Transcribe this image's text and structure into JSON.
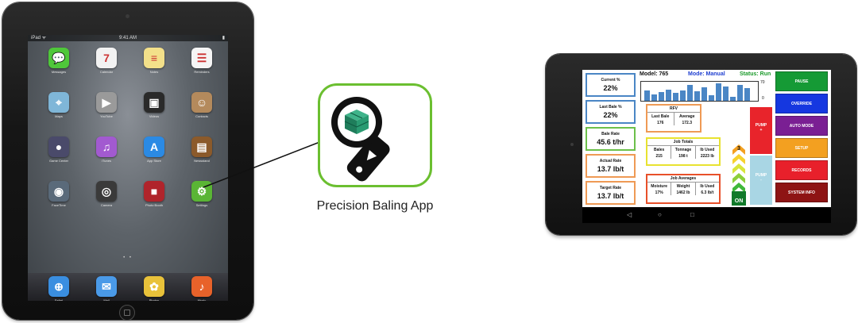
{
  "ipad": {
    "status": {
      "carrier": "iPad ᯤ",
      "clock": "9:41 AM",
      "battery": "▮"
    },
    "apps": [
      {
        "name": "Messages",
        "glyph": "💬",
        "color": "#4fc73a"
      },
      {
        "name": "Calendar",
        "glyph": "7",
        "color": "#f2f2f2"
      },
      {
        "name": "Notes",
        "glyph": "≡",
        "color": "#f3e08a"
      },
      {
        "name": "Reminders",
        "glyph": "☰",
        "color": "#f5f5f5"
      },
      {
        "name": "Maps",
        "glyph": "⌖",
        "color": "#7fb6d8"
      },
      {
        "name": "YouTube",
        "glyph": "▶",
        "color": "#9a9a9a"
      },
      {
        "name": "Videos",
        "glyph": "▣",
        "color": "#2a2a2a"
      },
      {
        "name": "Contacts",
        "glyph": "☺",
        "color": "#b48a5c"
      },
      {
        "name": "Game Center",
        "glyph": "●",
        "color": "#4a4a6a"
      },
      {
        "name": "iTunes",
        "glyph": "♫",
        "color": "#a25ad0"
      },
      {
        "name": "App Store",
        "glyph": "A",
        "color": "#2b8ae4"
      },
      {
        "name": "Newsstand",
        "glyph": "▤",
        "color": "#8b5a2b"
      },
      {
        "name": "FaceTime",
        "glyph": "◉",
        "color": "#5a6a7a"
      },
      {
        "name": "Camera",
        "glyph": "◎",
        "color": "#3a3a3a"
      },
      {
        "name": "Photo Booth",
        "glyph": "■",
        "color": "#b0242b"
      },
      {
        "name": "Settings",
        "glyph": "⚙",
        "color": "#5ab535"
      }
    ],
    "dock": [
      {
        "name": "Safari",
        "glyph": "⊕",
        "color": "#3a8ee0"
      },
      {
        "name": "Mail",
        "glyph": "✉",
        "color": "#4a9ae8"
      },
      {
        "name": "Photos",
        "glyph": "✿",
        "color": "#e9c23a"
      },
      {
        "name": "Music",
        "glyph": "♪",
        "color": "#e8622a"
      }
    ],
    "page_dots": "• •"
  },
  "app_caption": "Precision Baling App",
  "tablet": {
    "header": {
      "model": "Model: 765",
      "mode": "Mode: Manual",
      "status": "Status: Run"
    },
    "left_boxes": [
      {
        "label": "Current %",
        "value": "22%",
        "color": "#4a86c5"
      },
      {
        "label": "Last Bale %",
        "value": "22%",
        "color": "#4a86c5"
      },
      {
        "label": "Bale Rate",
        "value": "45.6 t/hr",
        "color": "#6cc04a"
      },
      {
        "label": "Actual Rate",
        "value": "13.7 lb/t",
        "color": "#ef9a55"
      },
      {
        "label": "Target Rate",
        "value": "13.7 lb/t",
        "color": "#ef9a55"
      }
    ],
    "graph": {
      "scale_max": "70",
      "scale_min": "0",
      "bars": [
        0.55,
        0.35,
        0.45,
        0.6,
        0.4,
        0.55,
        0.85,
        0.5,
        0.7,
        0.3,
        0.9,
        0.75,
        0.2,
        0.85,
        0.65
      ]
    },
    "rfv": {
      "title": "RFV",
      "cols": [
        {
          "header": "Last Bale",
          "value": "176"
        },
        {
          "header": "Average",
          "value": "172.3"
        }
      ]
    },
    "job_totals": {
      "title": "Job Totals",
      "cols": [
        {
          "header": "Bales",
          "value": "215"
        },
        {
          "header": "Tonnage",
          "value": "198 t"
        },
        {
          "header": "lb Used",
          "value": "2223 lb"
        }
      ]
    },
    "job_averages": {
      "title": "Job Averages",
      "cols": [
        {
          "header": "Moisture",
          "value": "17%"
        },
        {
          "header": "Weight",
          "value": "1462 lb"
        },
        {
          "header": "lb Used",
          "value": "6.3 lb/t"
        }
      ]
    },
    "pump_plus": {
      "label": "PUMP",
      "sign": "+",
      "color": "#e8242b"
    },
    "pump_minus": {
      "label": "PUMP",
      "sign": "-",
      "color": "#a9d6e4"
    },
    "chevron_level": "3",
    "on_label": "ON",
    "buttons": [
      {
        "label": "PAUSE",
        "color": "#159a35"
      },
      {
        "label": "OVERRIDE",
        "color": "#1537e0"
      },
      {
        "label": "AUTO MODE",
        "color": "#7a1f93"
      },
      {
        "label": "SETUP",
        "color": "#f3a020"
      },
      {
        "label": "RECORDS",
        "color": "#e8202b"
      },
      {
        "label": "SYSTEM INFO",
        "color": "#8e1414"
      }
    ],
    "nav": {
      "back": "◁",
      "home": "○",
      "recent": "□"
    }
  }
}
